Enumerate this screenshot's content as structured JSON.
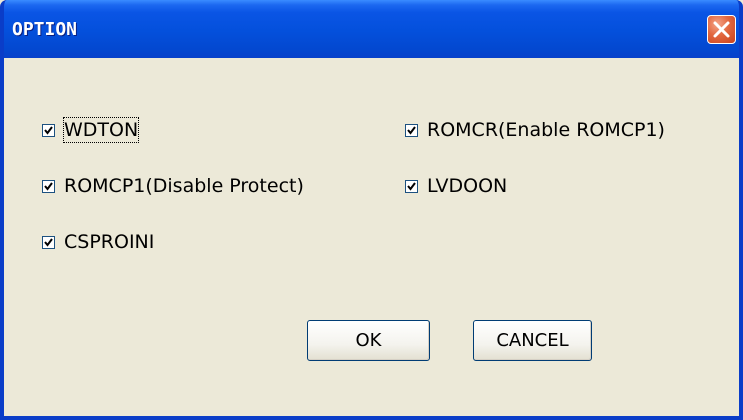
{
  "window": {
    "title": "OPTION"
  },
  "icons": {
    "close": "close-icon",
    "check": "checkmark-icon"
  },
  "colors": {
    "titlebar": "#0450DC",
    "close_button": "#E2673F",
    "dialog_background": "#ECE9D8"
  },
  "options": {
    "wdton": {
      "label": "WDTON",
      "checked": true
    },
    "romcr": {
      "label": "ROMCR(Enable ROMCP1)",
      "checked": true
    },
    "romcp1": {
      "label": "ROMCP1(Disable Protect)",
      "checked": true
    },
    "lvdoon": {
      "label": "LVDOON",
      "checked": true
    },
    "csproini": {
      "label": "CSPROINI",
      "checked": true
    }
  },
  "buttons": {
    "ok": "OK",
    "cancel": "CANCEL"
  }
}
